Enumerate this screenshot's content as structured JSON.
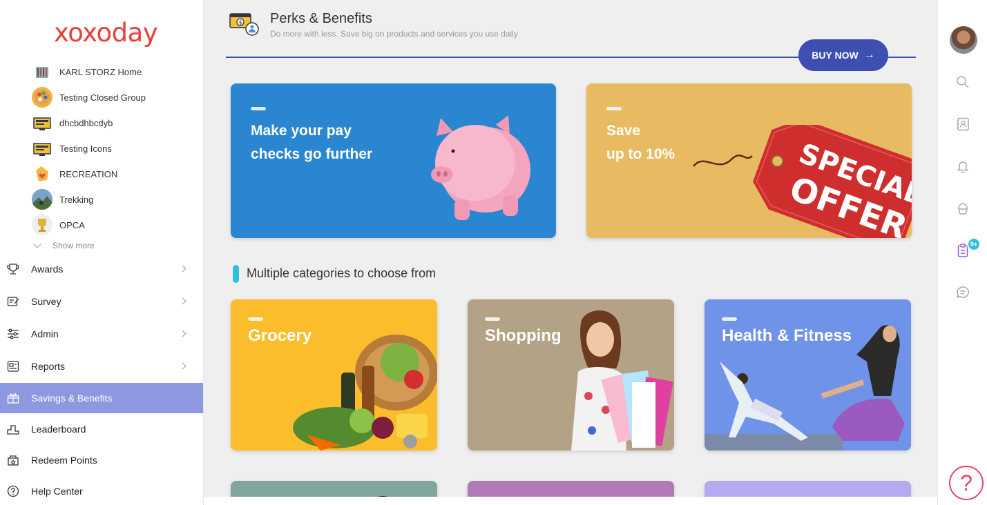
{
  "brand": {
    "logo_text": "xoxoday",
    "logo_color": "#e8413a"
  },
  "sidebar": {
    "groups": [
      {
        "label": "KARL STORZ Home",
        "icon": "building-icon"
      },
      {
        "label": "Testing Closed Group",
        "icon": "palette-icon"
      },
      {
        "label": "dhcbdhbcdyb",
        "icon": "screen-icon"
      },
      {
        "label": "Testing Icons",
        "icon": "screen-icon"
      },
      {
        "label": "RECREATION",
        "icon": "heart-hand-icon"
      },
      {
        "label": "Trekking",
        "icon": "mountain-icon"
      },
      {
        "label": "OPCA",
        "icon": "trophy-icon"
      }
    ],
    "show_more": "Show more",
    "nav": [
      {
        "label": "Awards",
        "icon": "trophy-icon",
        "has_arrow": true
      },
      {
        "label": "Survey",
        "icon": "survey-icon",
        "has_arrow": true
      },
      {
        "label": "Admin",
        "icon": "sliders-icon",
        "has_arrow": true
      },
      {
        "label": "Reports",
        "icon": "reports-icon",
        "has_arrow": true
      },
      {
        "label": "Savings & Benefits",
        "icon": "gift-icon",
        "active": true
      },
      {
        "label": "Leaderboard",
        "icon": "podium-icon"
      },
      {
        "label": "Redeem Points",
        "icon": "store-icon"
      },
      {
        "label": "Help Center",
        "icon": "help-icon"
      }
    ],
    "active_color": "#8e98e0"
  },
  "header": {
    "title": "Perks & Benefits",
    "subtitle": "Do more with less. Save big on products and services you use daily",
    "buy_now": "BUY NOW",
    "accent": "#3d4fb0"
  },
  "banners": [
    {
      "title_line1": "Make your pay",
      "title_line2": "checks go further",
      "color": "#2a86d0"
    },
    {
      "title_line1": "Save",
      "title_line2": "up to 10%",
      "color": "#e8bb62",
      "tag_line1": "SPECIAL",
      "tag_line2": "OFFER"
    }
  ],
  "categories_section": {
    "title": "Multiple categories to choose from",
    "items": [
      {
        "label": "Grocery",
        "color": "#fbbd2b"
      },
      {
        "label": "Shopping",
        "color": "#b3a286"
      },
      {
        "label": "Health & Fitness",
        "color": "#6e93e8"
      }
    ],
    "partial_row_colors": [
      "#7fa59d",
      "#b07bb5",
      "#b7a9f0"
    ]
  },
  "rail": {
    "icons": [
      "search-icon",
      "contacts-icon",
      "bell-icon",
      "cupcake-icon",
      "clipboard-icon",
      "chat-icon"
    ],
    "badge": "9+",
    "help": "?"
  }
}
